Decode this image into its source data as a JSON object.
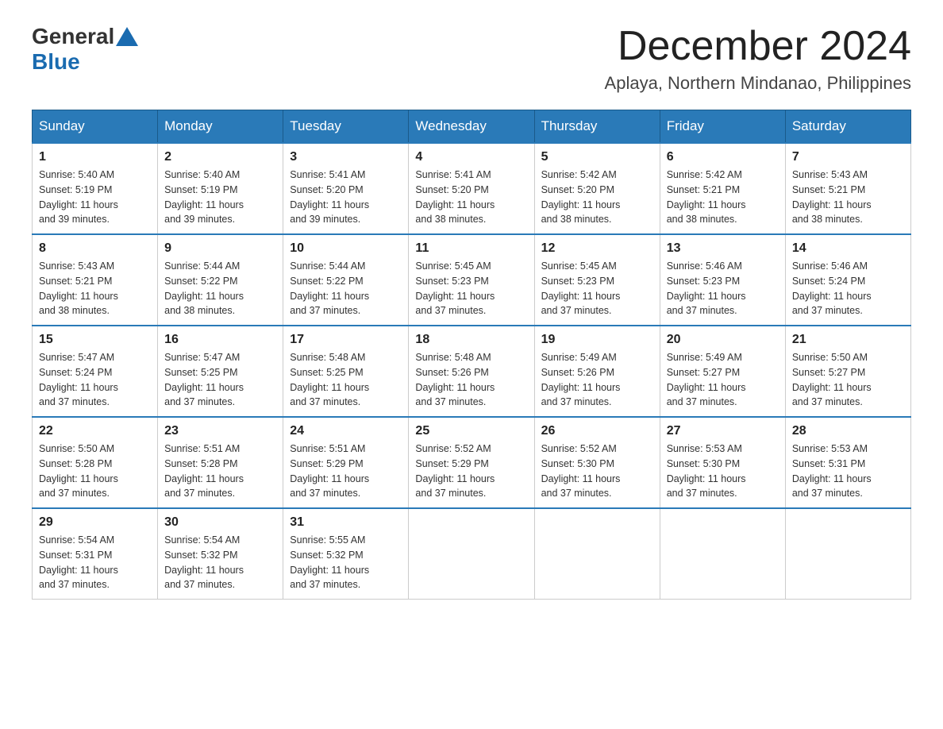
{
  "logo": {
    "general": "General",
    "blue": "Blue"
  },
  "header": {
    "month_year": "December 2024",
    "location": "Aplaya, Northern Mindanao, Philippines"
  },
  "days_of_week": [
    "Sunday",
    "Monday",
    "Tuesday",
    "Wednesday",
    "Thursday",
    "Friday",
    "Saturday"
  ],
  "weeks": [
    [
      {
        "day": "1",
        "sunrise": "5:40 AM",
        "sunset": "5:19 PM",
        "daylight": "11 hours and 39 minutes."
      },
      {
        "day": "2",
        "sunrise": "5:40 AM",
        "sunset": "5:19 PM",
        "daylight": "11 hours and 39 minutes."
      },
      {
        "day": "3",
        "sunrise": "5:41 AM",
        "sunset": "5:20 PM",
        "daylight": "11 hours and 39 minutes."
      },
      {
        "day": "4",
        "sunrise": "5:41 AM",
        "sunset": "5:20 PM",
        "daylight": "11 hours and 38 minutes."
      },
      {
        "day": "5",
        "sunrise": "5:42 AM",
        "sunset": "5:20 PM",
        "daylight": "11 hours and 38 minutes."
      },
      {
        "day": "6",
        "sunrise": "5:42 AM",
        "sunset": "5:21 PM",
        "daylight": "11 hours and 38 minutes."
      },
      {
        "day": "7",
        "sunrise": "5:43 AM",
        "sunset": "5:21 PM",
        "daylight": "11 hours and 38 minutes."
      }
    ],
    [
      {
        "day": "8",
        "sunrise": "5:43 AM",
        "sunset": "5:21 PM",
        "daylight": "11 hours and 38 minutes."
      },
      {
        "day": "9",
        "sunrise": "5:44 AM",
        "sunset": "5:22 PM",
        "daylight": "11 hours and 38 minutes."
      },
      {
        "day": "10",
        "sunrise": "5:44 AM",
        "sunset": "5:22 PM",
        "daylight": "11 hours and 37 minutes."
      },
      {
        "day": "11",
        "sunrise": "5:45 AM",
        "sunset": "5:23 PM",
        "daylight": "11 hours and 37 minutes."
      },
      {
        "day": "12",
        "sunrise": "5:45 AM",
        "sunset": "5:23 PM",
        "daylight": "11 hours and 37 minutes."
      },
      {
        "day": "13",
        "sunrise": "5:46 AM",
        "sunset": "5:23 PM",
        "daylight": "11 hours and 37 minutes."
      },
      {
        "day": "14",
        "sunrise": "5:46 AM",
        "sunset": "5:24 PM",
        "daylight": "11 hours and 37 minutes."
      }
    ],
    [
      {
        "day": "15",
        "sunrise": "5:47 AM",
        "sunset": "5:24 PM",
        "daylight": "11 hours and 37 minutes."
      },
      {
        "day": "16",
        "sunrise": "5:47 AM",
        "sunset": "5:25 PM",
        "daylight": "11 hours and 37 minutes."
      },
      {
        "day": "17",
        "sunrise": "5:48 AM",
        "sunset": "5:25 PM",
        "daylight": "11 hours and 37 minutes."
      },
      {
        "day": "18",
        "sunrise": "5:48 AM",
        "sunset": "5:26 PM",
        "daylight": "11 hours and 37 minutes."
      },
      {
        "day": "19",
        "sunrise": "5:49 AM",
        "sunset": "5:26 PM",
        "daylight": "11 hours and 37 minutes."
      },
      {
        "day": "20",
        "sunrise": "5:49 AM",
        "sunset": "5:27 PM",
        "daylight": "11 hours and 37 minutes."
      },
      {
        "day": "21",
        "sunrise": "5:50 AM",
        "sunset": "5:27 PM",
        "daylight": "11 hours and 37 minutes."
      }
    ],
    [
      {
        "day": "22",
        "sunrise": "5:50 AM",
        "sunset": "5:28 PM",
        "daylight": "11 hours and 37 minutes."
      },
      {
        "day": "23",
        "sunrise": "5:51 AM",
        "sunset": "5:28 PM",
        "daylight": "11 hours and 37 minutes."
      },
      {
        "day": "24",
        "sunrise": "5:51 AM",
        "sunset": "5:29 PM",
        "daylight": "11 hours and 37 minutes."
      },
      {
        "day": "25",
        "sunrise": "5:52 AM",
        "sunset": "5:29 PM",
        "daylight": "11 hours and 37 minutes."
      },
      {
        "day": "26",
        "sunrise": "5:52 AM",
        "sunset": "5:30 PM",
        "daylight": "11 hours and 37 minutes."
      },
      {
        "day": "27",
        "sunrise": "5:53 AM",
        "sunset": "5:30 PM",
        "daylight": "11 hours and 37 minutes."
      },
      {
        "day": "28",
        "sunrise": "5:53 AM",
        "sunset": "5:31 PM",
        "daylight": "11 hours and 37 minutes."
      }
    ],
    [
      {
        "day": "29",
        "sunrise": "5:54 AM",
        "sunset": "5:31 PM",
        "daylight": "11 hours and 37 minutes."
      },
      {
        "day": "30",
        "sunrise": "5:54 AM",
        "sunset": "5:32 PM",
        "daylight": "11 hours and 37 minutes."
      },
      {
        "day": "31",
        "sunrise": "5:55 AM",
        "sunset": "5:32 PM",
        "daylight": "11 hours and 37 minutes."
      },
      null,
      null,
      null,
      null
    ]
  ],
  "labels": {
    "sunrise": "Sunrise:",
    "sunset": "Sunset:",
    "daylight": "Daylight:"
  }
}
